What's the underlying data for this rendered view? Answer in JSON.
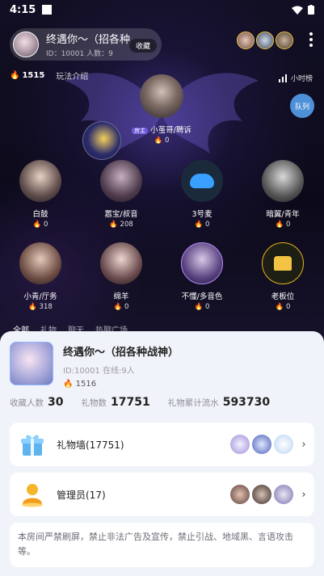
{
  "status_bar": {
    "time": "4:15"
  },
  "room": {
    "name": "终遇你～（招各种",
    "id_line": "ID：10001  人数：9",
    "favorite_label": "收藏",
    "heat": "1515",
    "intro_label": "玩法介绍",
    "rank_label": "小时榜",
    "queue_label": "队列"
  },
  "host": {
    "badge": "房主",
    "name": "小茧哥/聘诉",
    "fire": "0"
  },
  "seats": [
    {
      "name": "白鼓",
      "fire": "0"
    },
    {
      "name": "嚣宝/叔音",
      "fire": "208"
    },
    {
      "name": "3号麦",
      "fire": "0"
    },
    {
      "name": "暗翼/青年",
      "fire": "0"
    },
    {
      "name": "小青/厅务",
      "fire": "318"
    },
    {
      "name": "绵羊",
      "fire": "0"
    },
    {
      "name": "不懂/多音色",
      "fire": "0"
    },
    {
      "name": "老板位",
      "fire": "0"
    }
  ],
  "tabs": [
    "全部",
    "礼物",
    "聊天",
    "热聊广场"
  ],
  "sheet": {
    "title": "终遇你～（招各种战神）",
    "sub": "ID:10001  在线:9人",
    "heat": "1516",
    "favorites_label": "收藏人数",
    "favorites_value": "30",
    "gifts_label": "礼物数",
    "gifts_value": "17751",
    "flow_label": "礼物累计流水",
    "flow_value": "593730",
    "gift_wall_label": "礼物墙(17751)",
    "admins_label": "管理员(17)",
    "notice": "本房间严禁刷屏，禁止非法广告及宣传，禁止引战、地域黑、言语攻击等。"
  },
  "colors": {
    "accent": "#4d90d8",
    "fire": "#ff7a1a",
    "gold": "#f3c343",
    "sheet_bg": "#f1f3fa"
  },
  "icons": [
    "wifi-icon",
    "battery-icon",
    "fire-icon",
    "chart-icon",
    "gift-box-icon",
    "admin-person-icon",
    "chevron-right-icon",
    "more-dots-icon"
  ]
}
